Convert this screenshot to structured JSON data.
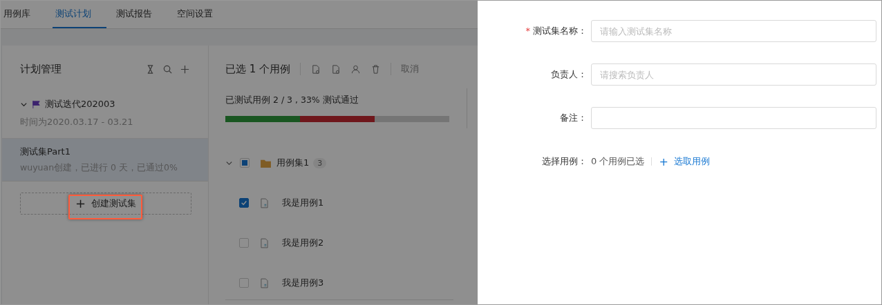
{
  "nav_tabs": [
    {
      "label": "用例库",
      "selected": false
    },
    {
      "label": "测试计划",
      "selected": true
    },
    {
      "label": "测试报告",
      "selected": false
    },
    {
      "label": "空间设置",
      "selected": false
    }
  ],
  "plan_panel": {
    "title": "计划管理",
    "iteration": {
      "name": "测试迭代202003",
      "expanded": true,
      "date": "时间为2020.03.17 - 03.21"
    },
    "test_sets": [
      {
        "name": "测试集Part1",
        "info": "wuyuan创建，已进行 0 天，已通过0%",
        "selected": true
      }
    ],
    "create_button": "创建测试集",
    "create_icon": "+"
  },
  "case_panel": {
    "selection_title": "已选 1 个用例",
    "cancel": "取消",
    "progress_text": "已测试用例 2 / 3 , 33% 测试通过",
    "progress": [
      {
        "kind": "tested",
        "level": 0.667
      },
      {
        "kind": "passed",
        "level": 0.333
      }
    ],
    "folder": {
      "name": "用例集1",
      "count": "3",
      "expanded": true,
      "checked": false,
      "indeterminate": true
    },
    "cases": [
      {
        "name": "我是用例1",
        "checked": true
      },
      {
        "name": "我是用例2",
        "checked": false
      },
      {
        "name": "我是用例3",
        "checked": false
      }
    ]
  },
  "drawer": {
    "fields": [
      {
        "label": "测试集名称：",
        "required_mark": "*",
        "placeholder": "请输入测试集名称"
      },
      {
        "label": "负责人：",
        "placeholder": "请搜索负责人"
      },
      {
        "label": "备注："
      }
    ],
    "case_select": {
      "label": "选择用例：",
      "count": "0 个用例已选",
      "link_icon": "+",
      "link": "选取用例"
    }
  }
}
